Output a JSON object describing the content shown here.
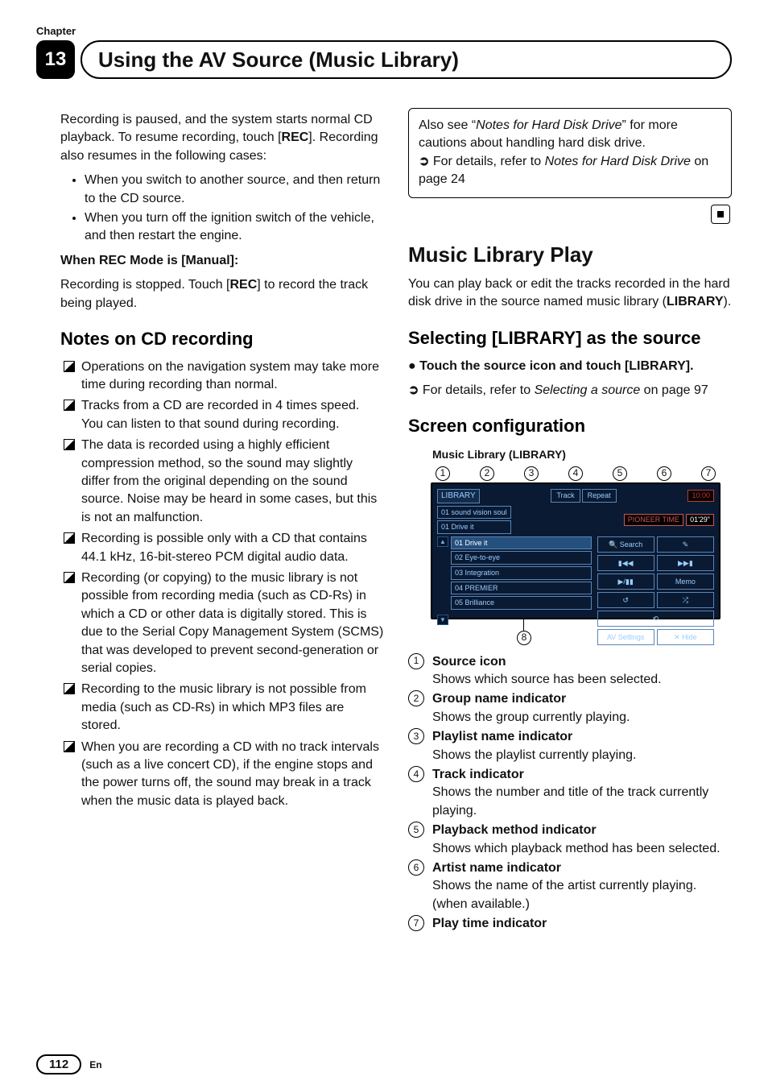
{
  "chapter": {
    "label": "Chapter",
    "number": "13",
    "title": "Using the AV Source (Music Library)"
  },
  "left": {
    "p1a": "Recording is paused, and the system starts normal CD playback. To resume recording, touch [",
    "p1b": "REC",
    "p1c": "]. Recording also resumes in the following cases:",
    "b1": "When you switch to another source, and then return to the CD source.",
    "b2": "When you turn off the ignition switch of the vehicle, and then restart the engine.",
    "h_manual": "When REC Mode is [Manual]:",
    "p2a": "Recording is stopped. Touch [",
    "p2b": "REC",
    "p2c": "] to record the track being played.",
    "h_notes": "Notes on CD recording",
    "n1": "Operations on the navigation system may take more time during recording than normal.",
    "n2": "Tracks from a CD are recorded in 4 times speed. You can listen to that sound during recording.",
    "n3": "The data is recorded using a highly efficient compression method, so the sound may slightly differ from the original depending on the sound source. Noise may be heard in some cases, but this is not an malfunction.",
    "n4": "Recording is possible only with a CD that contains 44.1 kHz, 16-bit-stereo PCM digital audio data.",
    "n5": "Recording (or copying) to the music library is not possible from recording media (such as CD-Rs) in which a CD or other data is digitally stored. This is due to the Serial Copy Management System (SCMS) that was developed to prevent second-generation or serial copies.",
    "n6": "Recording to the music library is not possible from media (such as CD-Rs) in which MP3 files are stored.",
    "n7": "When you are recording a CD with no track intervals (such as a live concert CD), if the engine stops and the power turns off, the sound may break in a track when the music data is played back."
  },
  "right": {
    "box_a": "Also see “",
    "box_b": "Notes for Hard Disk Drive",
    "box_c": "” for more cautions about handling hard disk drive.",
    "box_ref_a": "For details, refer to ",
    "box_ref_b": "Notes for Hard Disk Drive",
    "box_ref_c": " on page 24",
    "h_play": "Music Library Play",
    "p_play_a": "You can play back or edit the tracks recorded in the hard disk drive in the source named music library (",
    "p_play_b": "LIBRARY",
    "p_play_c": ").",
    "h_sel": "Selecting [LIBRARY] as the source",
    "sel_step": "Touch the source icon and touch [LIBRARY].",
    "sel_ref_a": "For details, refer to ",
    "sel_ref_b": "Selecting a source",
    "sel_ref_c": " on page 97",
    "h_screen": "Screen configuration",
    "shot_caption": "Music Library (LIBRARY)",
    "callouts": {
      "c1": "1",
      "c2": "2",
      "c3": "3",
      "c4": "4",
      "c5": "5",
      "c6": "6",
      "c7": "7",
      "c8": "8"
    },
    "items": {
      "i1_label": "Source icon",
      "i1_desc": "Shows which source has been selected.",
      "i2_label": "Group name indicator",
      "i2_desc": "Shows the group currently playing.",
      "i3_label": "Playlist name indicator",
      "i3_desc": "Shows the playlist currently playing.",
      "i4_label": "Track indicator",
      "i4_desc": "Shows the number and title of the track currently playing.",
      "i5_label": "Playback method indicator",
      "i5_desc": "Shows which playback method has been selected.",
      "i6_label": "Artist name indicator",
      "i6_desc": "Shows the name of the artist currently playing. (when available.)",
      "i7_label": "Play time indicator"
    },
    "shot": {
      "src_label": "LIBRARY",
      "tab1": "Track",
      "tab2": "Repeat",
      "clock": "10:00",
      "meta1": "01 sound vision soul",
      "meta2": "01 Drive it",
      "pioneer": "PIONEER TIME",
      "dur": "01'29\"",
      "tracks": {
        "t1": "01 Drive it",
        "t2": "02 Eye-to-eye",
        "t3": "03 Integration",
        "t4": "04 PREMIER",
        "t5": "05 Brilliance"
      },
      "btn_search": "🔍 Search",
      "btn_edit": "✎",
      "btn_prev": "▮◀◀",
      "btn_next": "▶▶▮",
      "btn_play": "▶/▮▮",
      "btn_memo": "Memo",
      "btn_rpt": "↺",
      "btn_shf": "⤮",
      "btn_scan": "⟲",
      "btn_av": "AV Settings",
      "btn_hide": "✕ Hide",
      "nav_up": "▲",
      "nav_dn": "▼"
    }
  },
  "footer": {
    "page": "112",
    "lang": "En"
  }
}
